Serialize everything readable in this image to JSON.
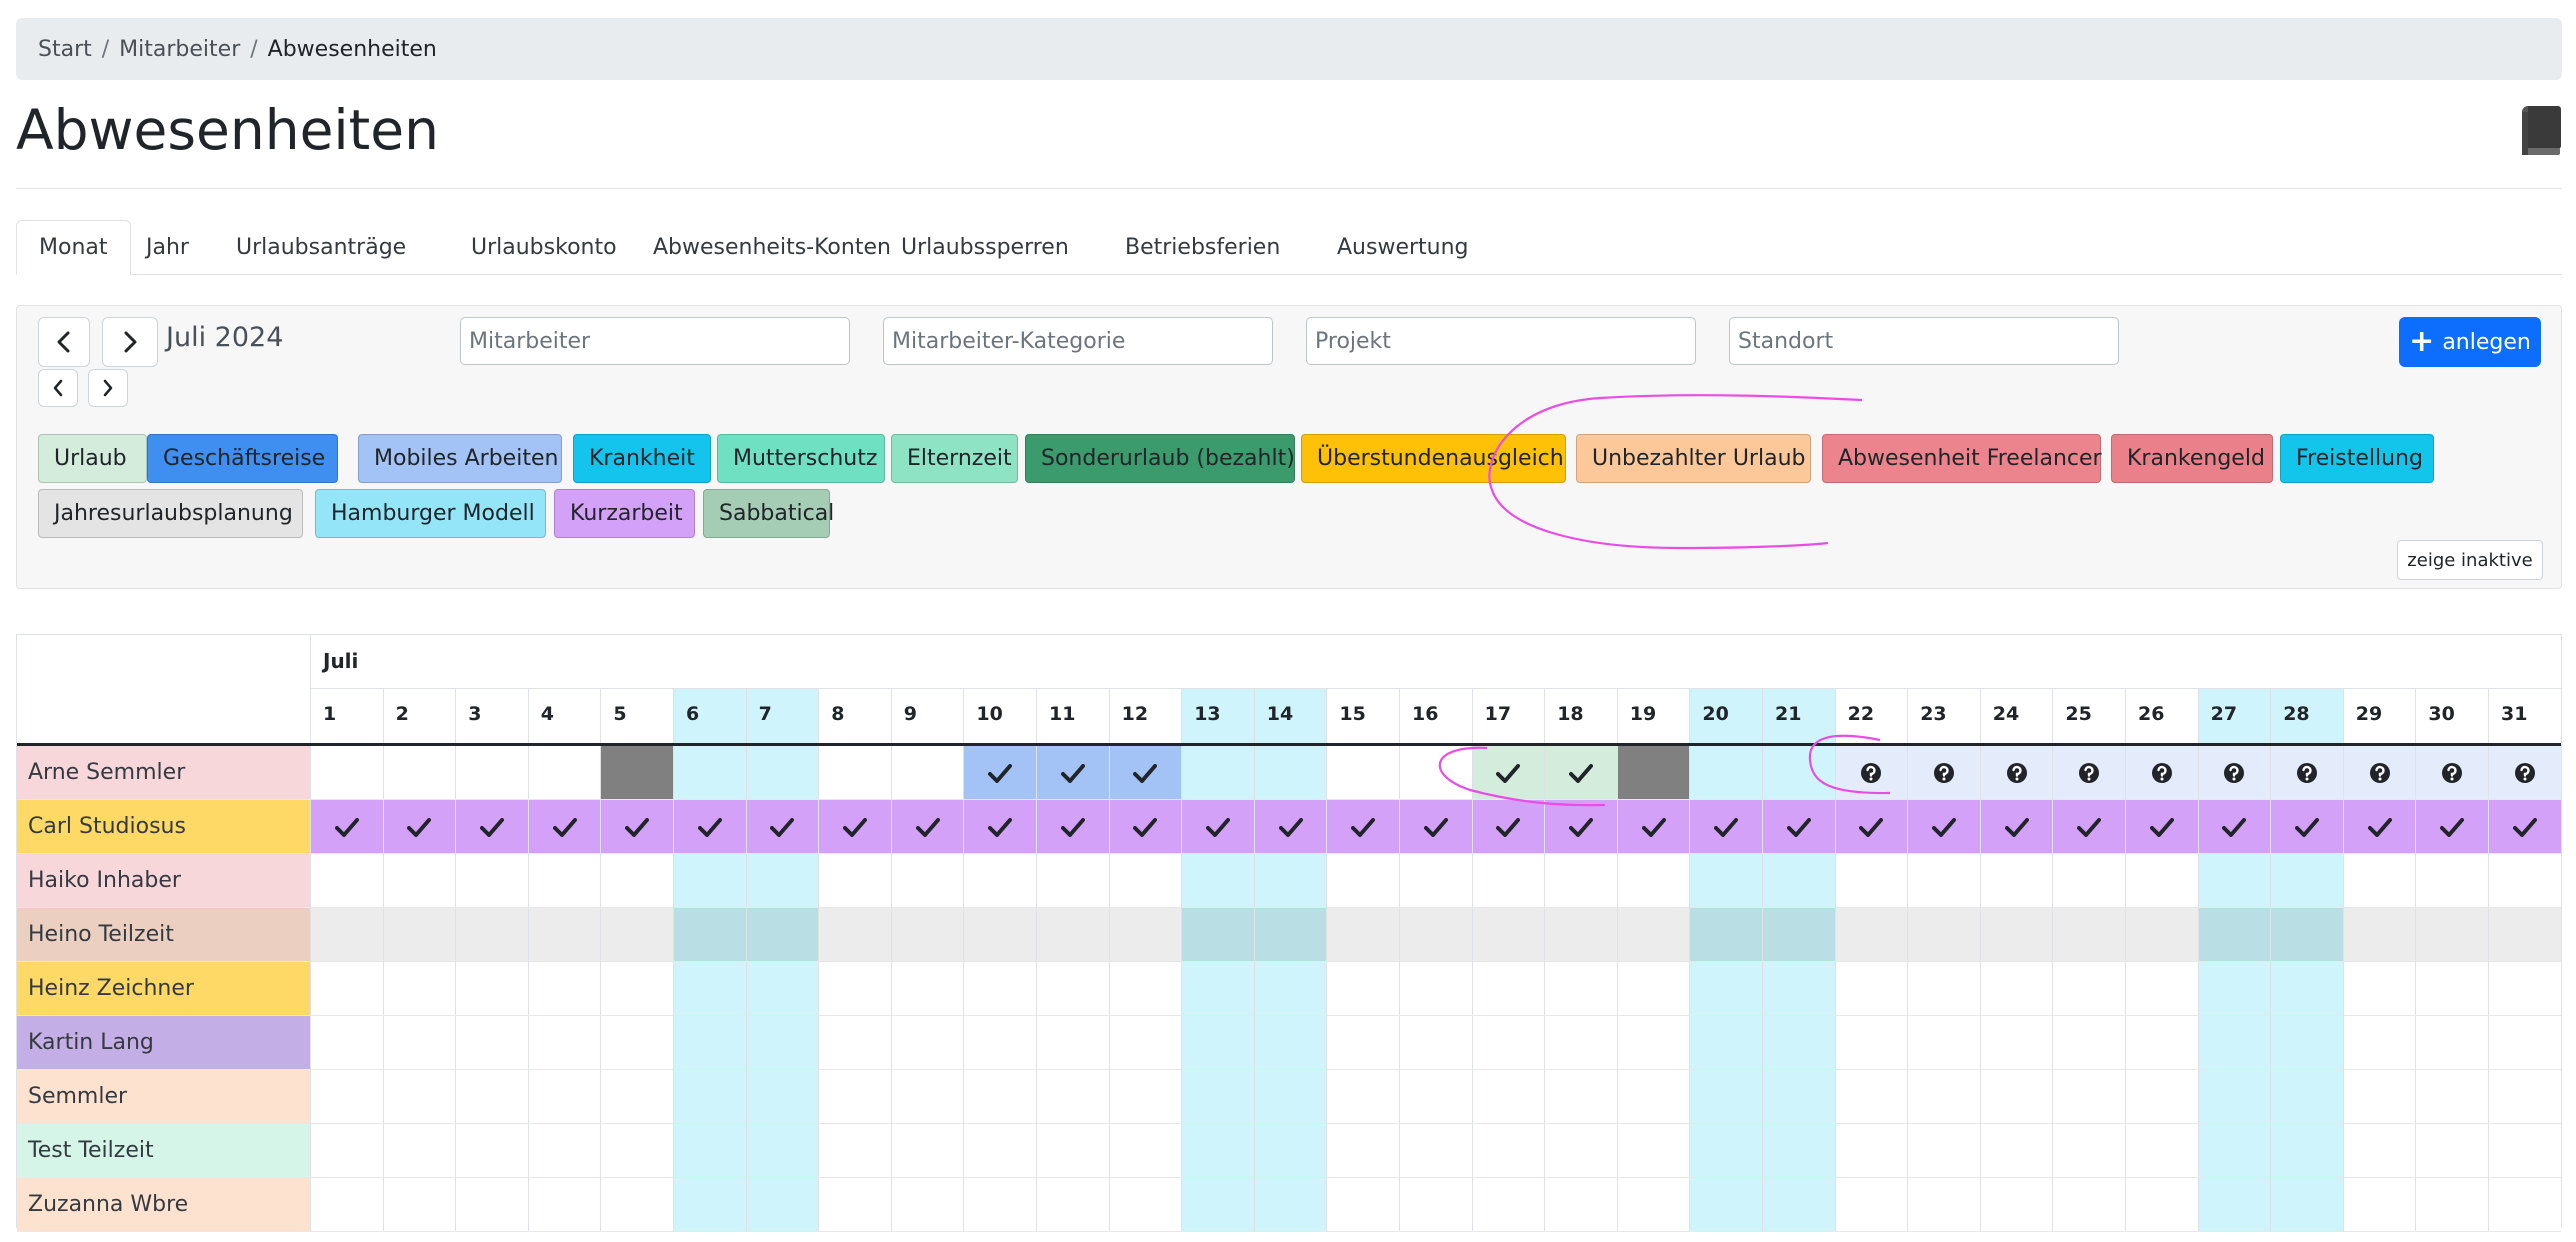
{
  "breadcrumb": {
    "items": [
      "Start",
      "Mitarbeiter",
      "Abwesenheiten"
    ]
  },
  "page": {
    "title": "Abwesenheiten"
  },
  "tabs": [
    "Monat",
    "Jahr",
    "Urlaubsanträge",
    "Urlaubskonto",
    "Abwesenheits-Konten",
    "Urlaubssperren",
    "Betriebsferien",
    "Auswertung"
  ],
  "active_tab": "Monat",
  "toolbar": {
    "month_label": "Juli 2024",
    "filters": {
      "employee": "Mitarbeiter",
      "category": "Mitarbeiter-Kategorie",
      "project": "Projekt",
      "location": "Standort"
    },
    "create_label": "anlegen",
    "show_inactive_label": "zeige inaktive"
  },
  "legend": [
    {
      "label": "Urlaub",
      "color": "#d3ecdc"
    },
    {
      "label": "Geschäftsreise",
      "color": "#3f8ff0"
    },
    {
      "label": "Mobiles Arbeiten",
      "color": "#a3c3f7"
    },
    {
      "label": "Krankheit",
      "color": "#14c4ec"
    },
    {
      "label": "Mutterschutz",
      "color": "#6fe0c2"
    },
    {
      "label": "Elternzeit",
      "color": "#8ee3c5"
    },
    {
      "label": "Sonderurlaub (bezahlt)",
      "color": "#3b9b6d"
    },
    {
      "label": "Überstundenausgleich",
      "color": "#ffc107"
    },
    {
      "label": "Unbezahlter Urlaub",
      "color": "#fdc899"
    },
    {
      "label": "Abwesenheit Freelancer",
      "color": "#ec848d"
    },
    {
      "label": "Krankengeld",
      "color": "#ea8089"
    },
    {
      "label": "Freistellung",
      "color": "#14c5eb"
    },
    {
      "label": "Jahresurlaubsplanung",
      "color": "#e4e4e4"
    },
    {
      "label": "Hamburger Modell",
      "color": "#94e5f8"
    },
    {
      "label": "Kurzarbeit",
      "color": "#d3a2f8"
    },
    {
      "label": "Sabbatical",
      "color": "#a5cdb5"
    }
  ],
  "calendar": {
    "month": "Juli",
    "days": [
      "1",
      "2",
      "3",
      "4",
      "5",
      "6",
      "7",
      "8",
      "9",
      "10",
      "11",
      "12",
      "13",
      "14",
      "15",
      "16",
      "17",
      "18",
      "19",
      "20",
      "21",
      "22",
      "23",
      "24",
      "25",
      "26",
      "27",
      "28",
      "29",
      "30",
      "31"
    ],
    "weekend_color": "#cff4fc",
    "employees": [
      {
        "name": "Arne Semmler",
        "color": "#f8d7da"
      },
      {
        "name": "Carl Studiosus",
        "color": "#ffd966"
      },
      {
        "name": "Haiko Inhaber",
        "color": "#f8d7da"
      },
      {
        "name": "Heino Teilzeit",
        "color": "#ebd0c2"
      },
      {
        "name": "Heinz Zeichner",
        "color": "#ffd966"
      },
      {
        "name": "Kartin Lang",
        "color": "#c3aee6"
      },
      {
        "name": "Semmler",
        "color": "#fee2d0"
      },
      {
        "name": "Test Teilzeit",
        "color": "#d5f5e8"
      },
      {
        "name": "Zuzanna Wbre",
        "color": "#fee2d0"
      }
    ],
    "entries": [
      {
        "employee": "Arne Semmler",
        "days": [
          5,
          19
        ],
        "type": "Blocked",
        "color": "#808080",
        "mark": "none"
      },
      {
        "employee": "Arne Semmler",
        "days": [
          10,
          11,
          12
        ],
        "type": "Mobiles Arbeiten",
        "color": "#a3c3f7",
        "mark": "check"
      },
      {
        "employee": "Arne Semmler",
        "days": [
          17,
          18
        ],
        "type": "Urlaub",
        "color": "#d3ecdc",
        "mark": "check"
      },
      {
        "employee": "Arne Semmler",
        "days": [
          22,
          23,
          24,
          25,
          26,
          27,
          28,
          29,
          30,
          31
        ],
        "type": "Jahresurlaubsplanung",
        "color": "#e4ecfb",
        "mark": "question"
      },
      {
        "employee": "Carl Studiosus",
        "days": [
          1,
          2,
          3,
          4,
          5,
          6,
          7,
          8,
          9,
          10,
          11,
          12,
          13,
          14,
          15,
          16,
          17,
          18,
          19,
          20,
          21,
          22,
          23,
          24,
          25,
          26,
          27,
          28,
          29,
          30,
          31
        ],
        "type": "Kurzarbeit",
        "color": "#d3a2f8",
        "mark": "check"
      }
    ]
  }
}
